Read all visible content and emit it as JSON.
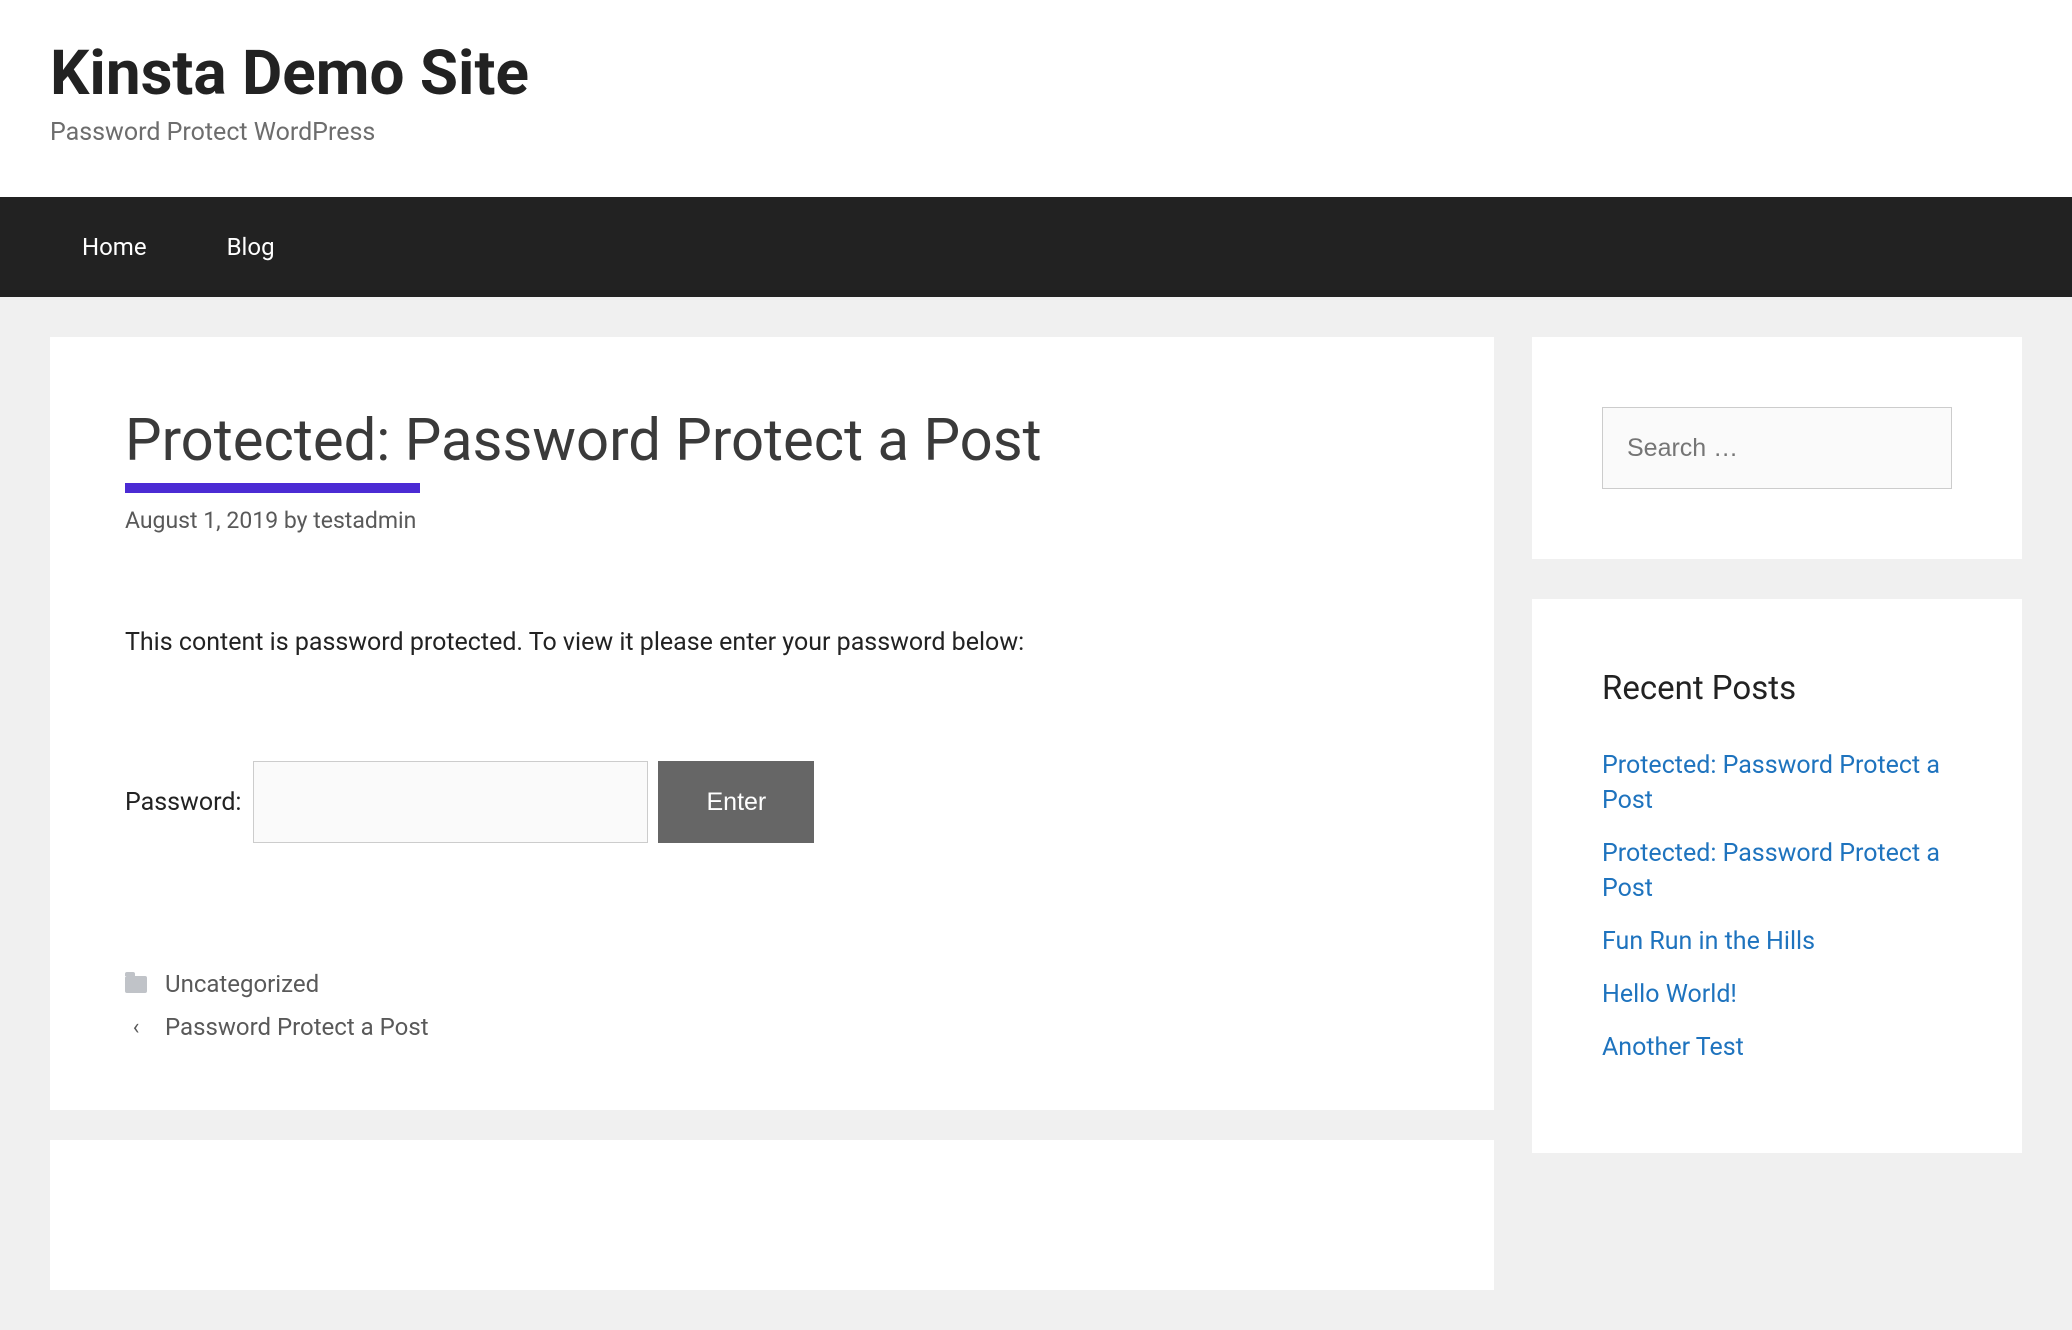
{
  "header": {
    "site_title": "Kinsta Demo Site",
    "tagline": "Password Protect WordPress"
  },
  "nav": {
    "items": [
      {
        "label": "Home"
      },
      {
        "label": "Blog"
      }
    ]
  },
  "post": {
    "title_prefix": "Protected:",
    "title_rest": " Password Protect a Post",
    "date": "August 1, 2019",
    "by_text": " by ",
    "author": "testadmin",
    "protected_message": "This content is password protected. To view it please enter your password below:",
    "password_label": "Password:",
    "password_value": "",
    "submit_label": "Enter",
    "category": "Uncategorized",
    "prev_link": "Password Protect a Post"
  },
  "sidebar": {
    "search_placeholder": "Search …",
    "recent_title": "Recent Posts",
    "recent_posts": [
      {
        "title": "Protected: Password Protect a Post"
      },
      {
        "title": "Protected: Password Protect a Post"
      },
      {
        "title": "Fun Run in the Hills"
      },
      {
        "title": "Hello World!"
      },
      {
        "title": "Another Test"
      }
    ]
  }
}
